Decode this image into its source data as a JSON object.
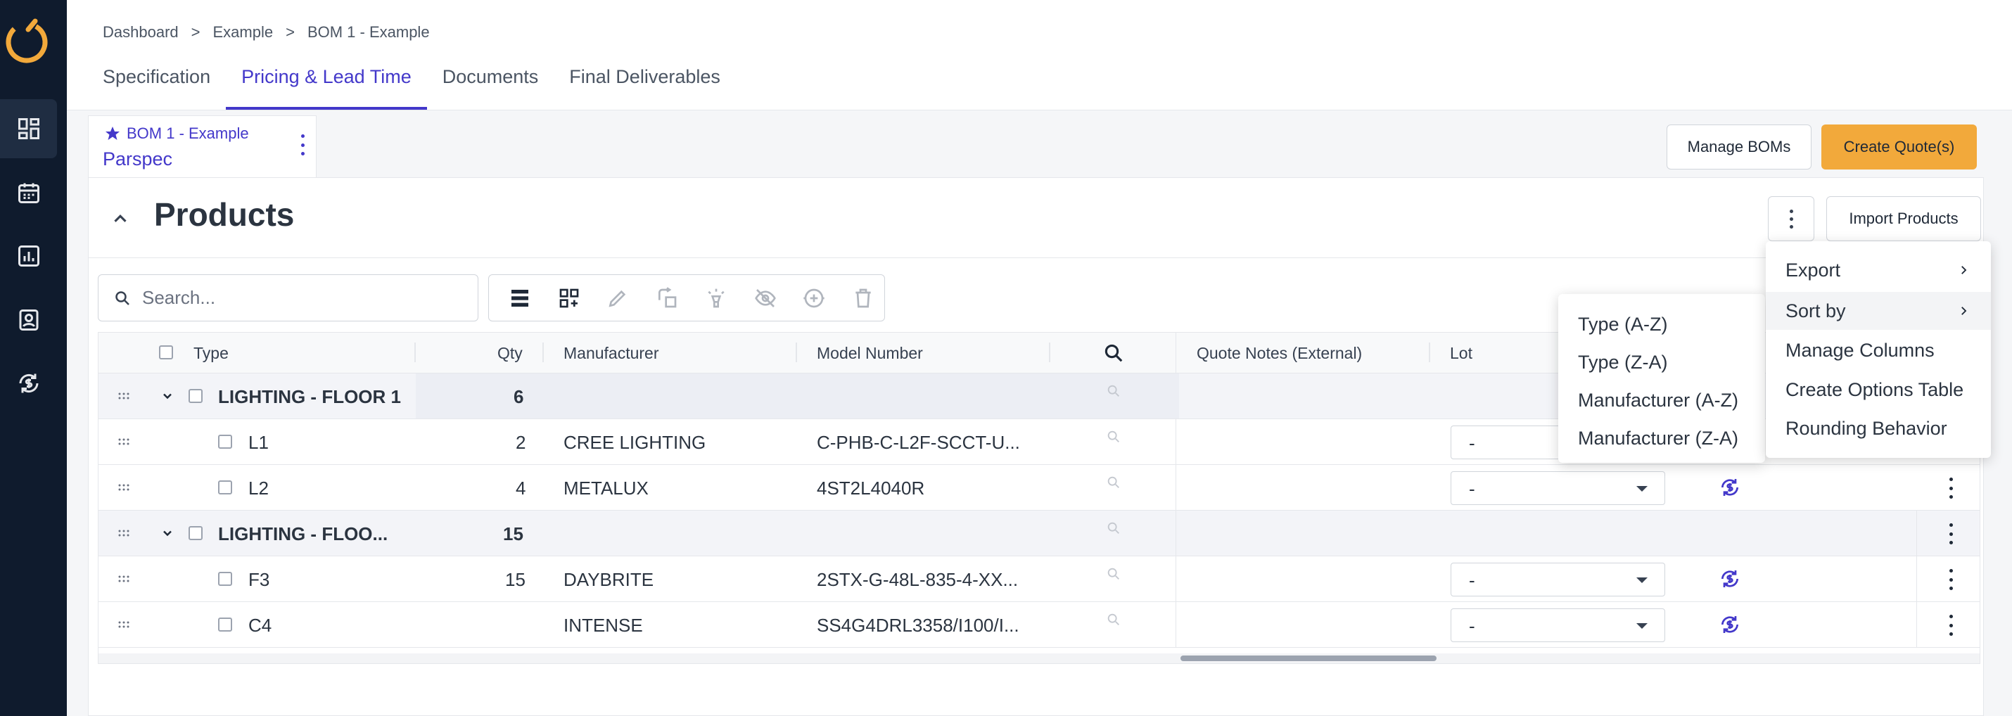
{
  "breadcrumb": {
    "items": [
      "Dashboard",
      "Example",
      "BOM 1 - Example"
    ],
    "separator": ">"
  },
  "tabs": [
    "Specification",
    "Pricing & Lead Time",
    "Documents",
    "Final Deliverables"
  ],
  "bom_card": {
    "title": "BOM 1 - Example",
    "subtitle": "Parspec"
  },
  "header_buttons": {
    "manage": "Manage BOMs",
    "create": "Create Quote(s)"
  },
  "products": {
    "title": "Products",
    "import_button": "Import Products",
    "search_placeholder": "Search..."
  },
  "table": {
    "columns": {
      "type": "Type",
      "qty": "Qty",
      "manufacturer": "Manufacturer",
      "model": "Model Number",
      "quote_notes": "Quote Notes (External)",
      "lot": "Lot"
    },
    "rows": [
      {
        "type": "LIGHTING - FLOOR 1",
        "qty": "6",
        "manufacturer": "",
        "model": "",
        "lot": ""
      },
      {
        "type": "L1",
        "qty": "2",
        "manufacturer": "CREE LIGHTING",
        "model": "C-PHB-C-L2F-SCCT-U...",
        "lot": "-"
      },
      {
        "type": "L2",
        "qty": "4",
        "manufacturer": "METALUX",
        "model": "4ST2L4040R",
        "lot": "-"
      },
      {
        "type": "LIGHTING - FLOO...",
        "qty": "15",
        "manufacturer": "",
        "model": "",
        "lot": ""
      },
      {
        "type": "F3",
        "qty": "15",
        "manufacturer": "DAYBRITE",
        "model": "2STX-G-48L-835-4-XX...",
        "lot": "-"
      },
      {
        "type": "C4",
        "qty": "",
        "manufacturer": "INTENSE",
        "model": "SS4G4DRL3358/I100/I...",
        "lot": "-"
      }
    ]
  },
  "main_menu": {
    "items": [
      "Export",
      "Sort by",
      "Manage Columns",
      "Create Options Table",
      "Rounding Behavior"
    ]
  },
  "sort_menu": {
    "items": [
      "Type (A-Z)",
      "Type (Z-A)",
      "Manufacturer (A-Z)",
      "Manufacturer (Z-A)"
    ]
  },
  "colors": {
    "accent": "#4338ca",
    "primary_button": "#f2a93b",
    "sidebar": "#0f1b2d",
    "logo": "#f2a93b"
  },
  "icons": {
    "sidebar": [
      "dashboard-icon",
      "calendar-icon",
      "reports-icon",
      "contacts-icon",
      "sync-dollar-icon"
    ],
    "toolbar": [
      "section-icon",
      "add-kit-icon",
      "edit-icon",
      "replace-icon",
      "highlight-icon",
      "hide-icon",
      "add-option-icon",
      "delete-icon"
    ]
  }
}
